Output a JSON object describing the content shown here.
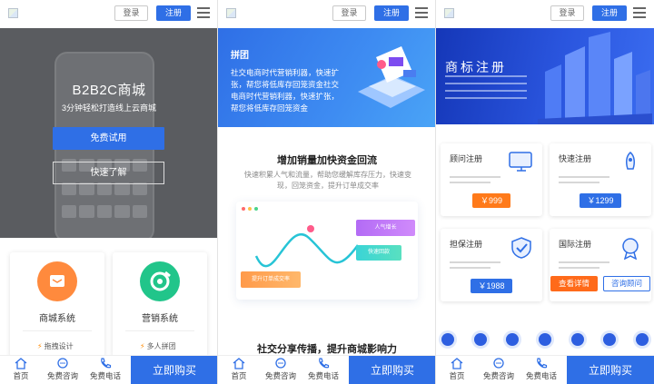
{
  "header": {
    "login_label": "登录",
    "register_label": "注册"
  },
  "bottom_bar": {
    "home_label": "首页",
    "consult_label": "免费咨询",
    "phone_label": "免费电话",
    "buy_label": "立即购买"
  },
  "screen1": {
    "hero_title": "B2B2C商城",
    "hero_subtitle": "3分钟轻松打造线上云商城",
    "free_trial_label": "免费试用",
    "learn_more_label": "快速了解",
    "cards": [
      {
        "title": "商城系统",
        "feature": "拖拽设计",
        "color": "#ff8a3d"
      },
      {
        "title": "营销系统",
        "feature": "多人拼团",
        "color": "#21c58a"
      }
    ]
  },
  "screen2": {
    "hero_title": "拼团",
    "hero_desc": "社交电商时代营销利器，快速扩张，帮您将低库存回笼资金社交电商时代营销利器，快速扩张，帮您将低库存回笼资金",
    "section_title": "增加销量加快资金回流",
    "section_desc": "快速积累人气和流量，帮助您缓解库存压力，快速变现，回笼资金，提升订单成交率",
    "chart_tags": [
      "人气增长",
      "快速回款",
      "提升订单成交率"
    ],
    "section2_title": "社交分享传播，提升商城影响力"
  },
  "screen3": {
    "hero_title": "商标注册",
    "products": [
      {
        "name": "顾问注册",
        "price": "￥999",
        "pill_color": "#ff7a1a"
      },
      {
        "name": "快速注册",
        "price": "￥1299",
        "pill_color": "#2f6fe6"
      },
      {
        "name": "担保注册",
        "price": "￥1988",
        "pill_color": "#2f6fe6"
      },
      {
        "name": "国际注册",
        "price": "",
        "pill_color": "#2f6fe6"
      }
    ],
    "detail_label": "查看详情",
    "consult_label": "咨询顾问"
  }
}
